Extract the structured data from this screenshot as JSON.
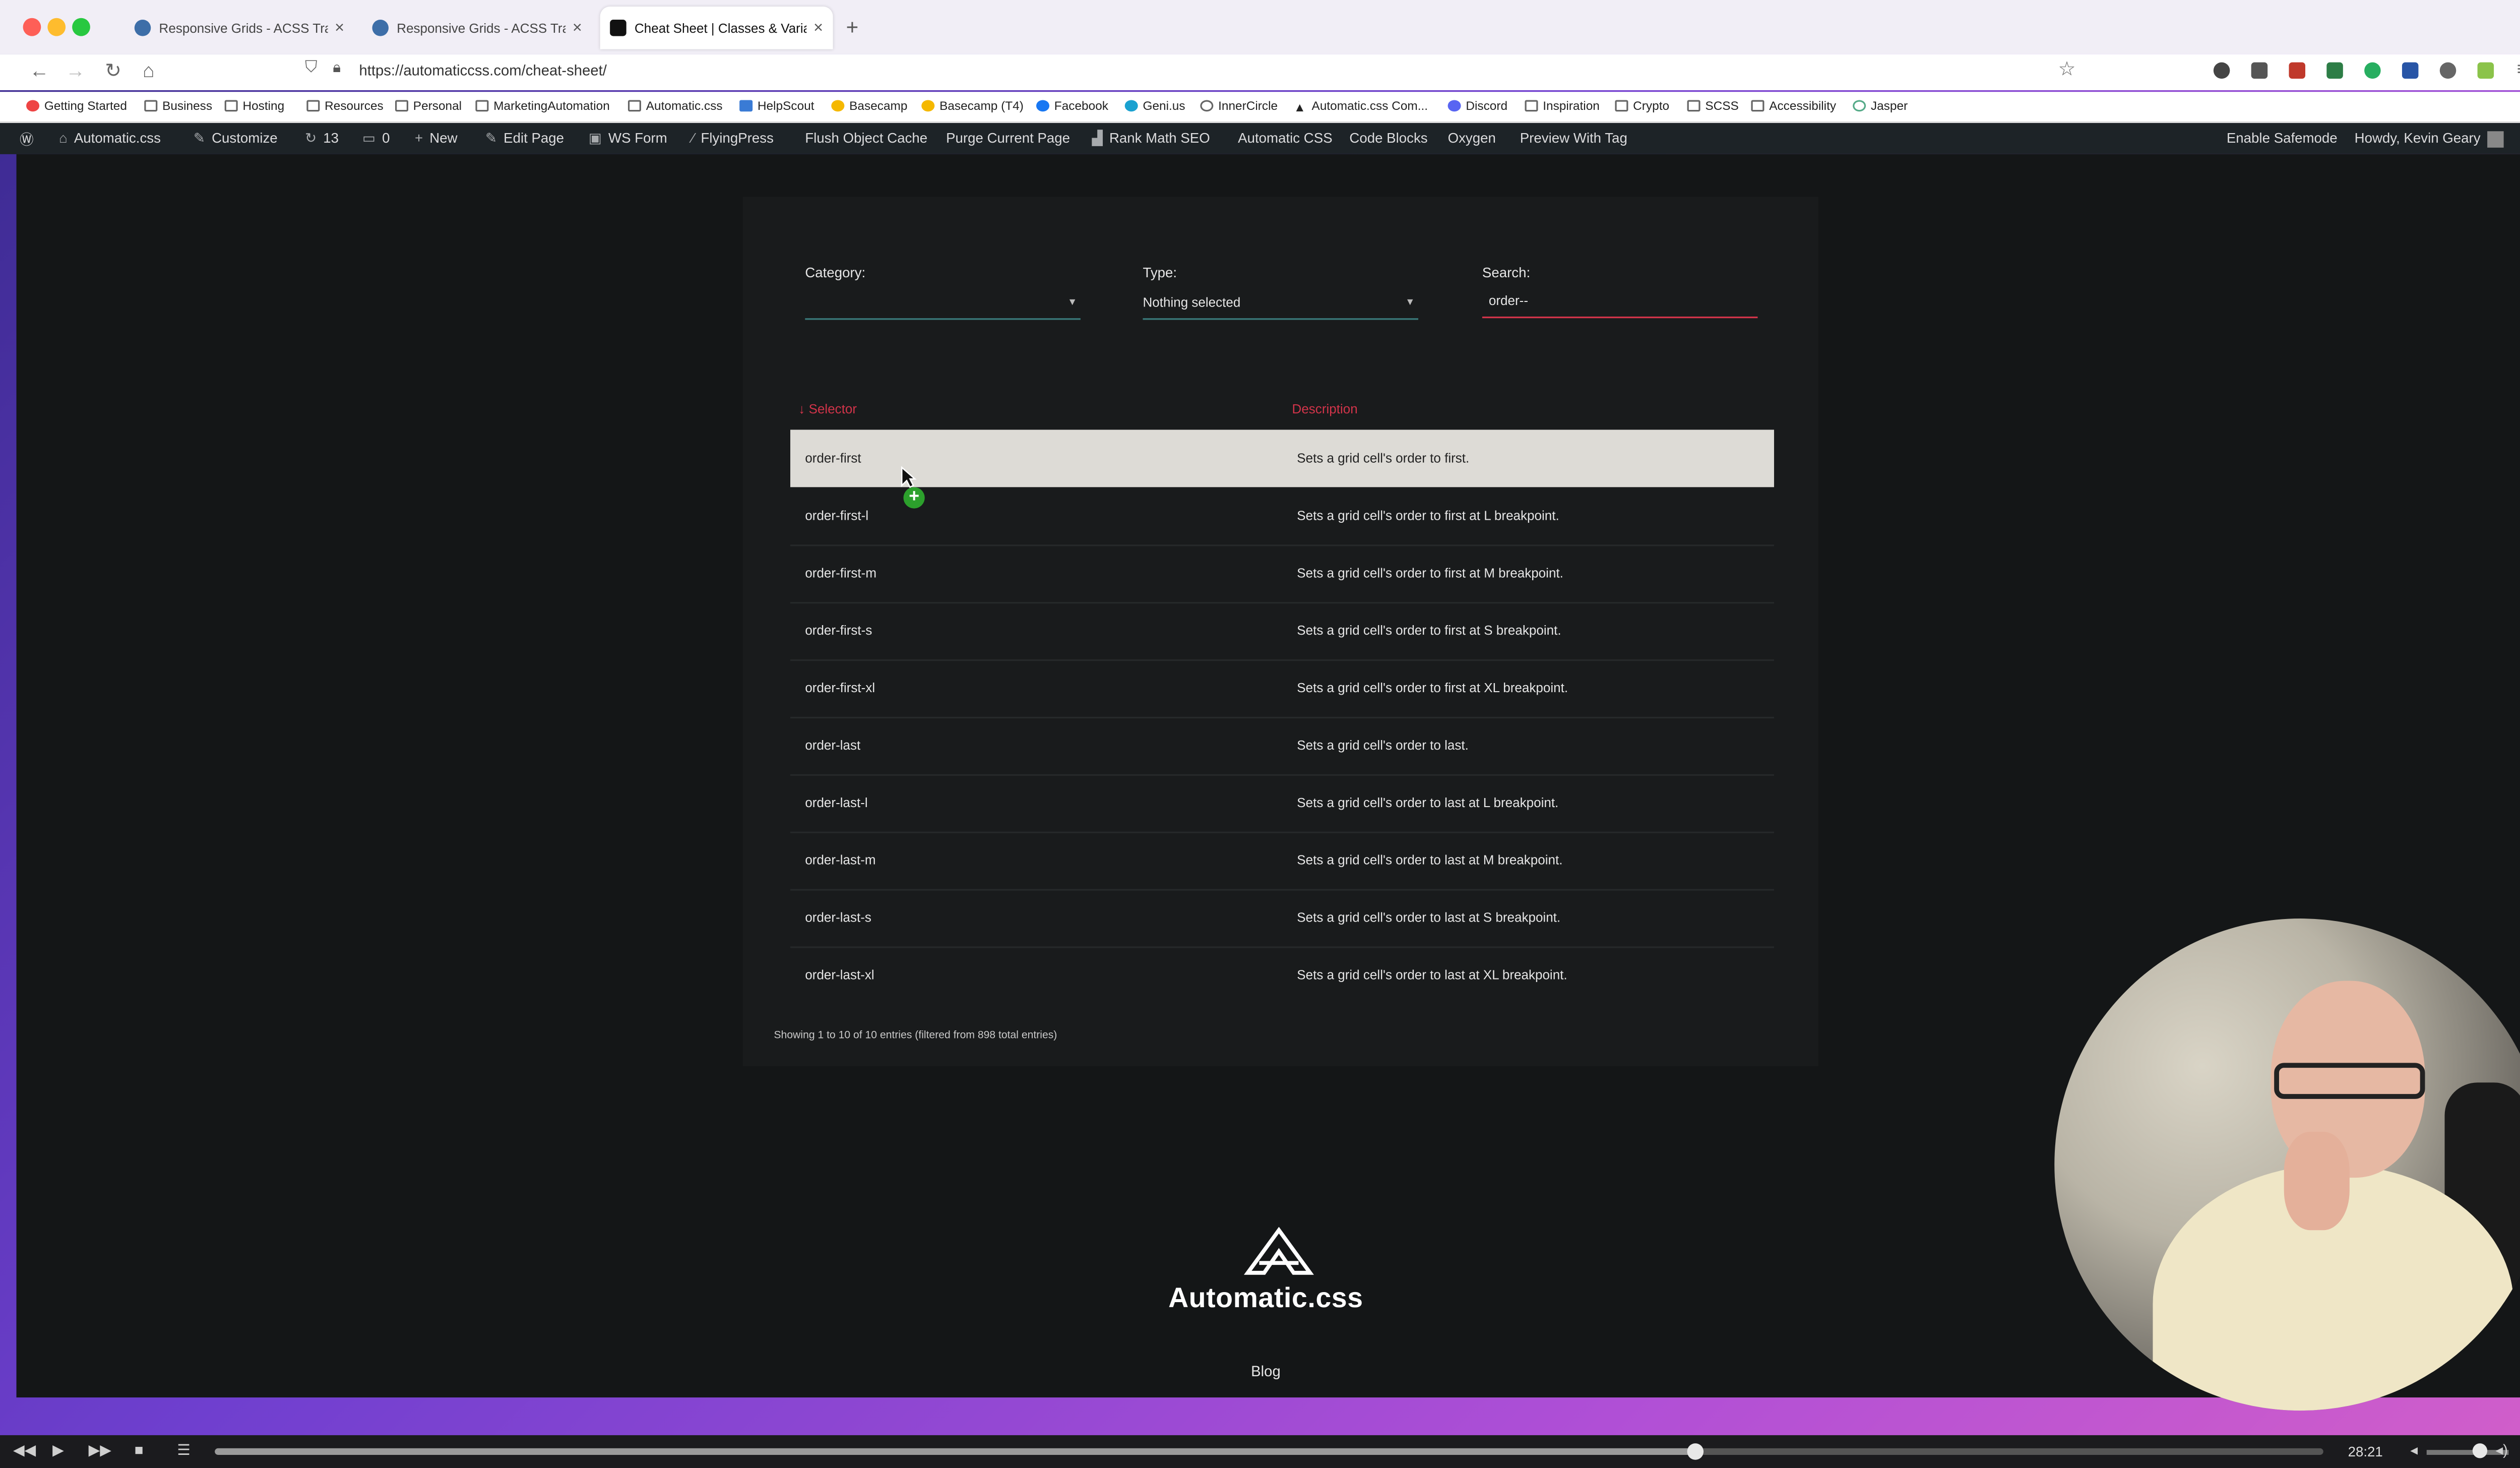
{
  "browser": {
    "tabs": [
      {
        "title": "Responsive Grids - ACSS Traini"
      },
      {
        "title": "Responsive Grids - ACSS Traini"
      },
      {
        "title": "Cheat Sheet | Classes & Variab"
      }
    ],
    "url": "https://automaticcss.com/cheat-sheet/"
  },
  "bookmarks": [
    "Getting Started",
    "Business",
    "Hosting",
    "Resources",
    "Personal",
    "MarketingAutomation",
    "Automatic.css",
    "HelpScout",
    "Basecamp",
    "Basecamp (T4)",
    "Facebook",
    "Geni.us",
    "InnerCircle",
    "Automatic.css Com...",
    "Discord",
    "Inspiration",
    "Crypto",
    "SCSS",
    "Accessibility",
    "Jasper"
  ],
  "wp_admin_bar": {
    "site": "Automatic.css",
    "customize": "Customize",
    "updates": "13",
    "comments": "0",
    "new": "New",
    "edit": "Edit Page",
    "wsform": "WS Form",
    "flyingpress": "FlyingPress",
    "flush": "Flush Object Cache",
    "purge": "Purge Current Page",
    "rankmath": "Rank Math SEO",
    "acss": "Automatic CSS",
    "codeblocks": "Code Blocks",
    "oxygen": "Oxygen",
    "preview": "Preview With Tag",
    "safemode": "Enable Safemode",
    "howdy": "Howdy, Kevin Geary"
  },
  "filters": {
    "category_label": "Category:",
    "category_value": "",
    "type_label": "Type:",
    "type_value": "Nothing selected",
    "search_label": "Search:",
    "search_value": "order--"
  },
  "table": {
    "headers": {
      "selector": "Selector",
      "description": "Description"
    },
    "rows": [
      {
        "selector": "order-first",
        "description": "Sets a grid cell's order to first."
      },
      {
        "selector": "order-first-l",
        "description": "Sets a grid cell's order to first at L breakpoint."
      },
      {
        "selector": "order-first-m",
        "description": "Sets a grid cell's order to first at M breakpoint."
      },
      {
        "selector": "order-first-s",
        "description": "Sets a grid cell's order to first at S breakpoint."
      },
      {
        "selector": "order-first-xl",
        "description": "Sets a grid cell's order to first at XL breakpoint."
      },
      {
        "selector": "order-last",
        "description": "Sets a grid cell's order to last."
      },
      {
        "selector": "order-last-l",
        "description": "Sets a grid cell's order to last at L breakpoint."
      },
      {
        "selector": "order-last-m",
        "description": "Sets a grid cell's order to last at M breakpoint."
      },
      {
        "selector": "order-last-s",
        "description": "Sets a grid cell's order to last at S breakpoint."
      },
      {
        "selector": "order-last-xl",
        "description": "Sets a grid cell's order to last at XL breakpoint."
      }
    ],
    "info": "Showing 1 to 10 of 10 entries (filtered from 898 total entries)"
  },
  "footer": {
    "brand": "Automatic.css",
    "blog": "Blog"
  },
  "player": {
    "time": "28:21",
    "progress": 0.702
  },
  "colors": {
    "accent": "#d2344a",
    "page_bg": "#141617",
    "highlight_row": "#dddbd6"
  }
}
